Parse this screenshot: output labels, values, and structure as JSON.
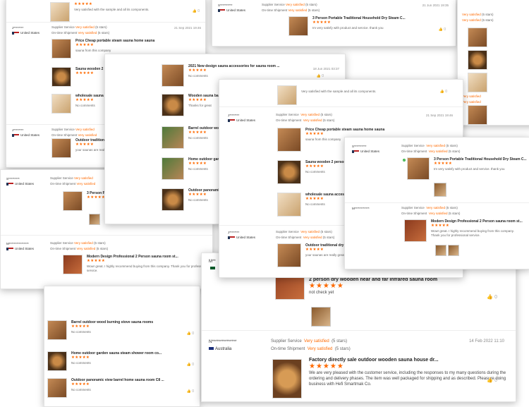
{
  "common": {
    "supplier_service": "Supplier Service",
    "ontime_shipment": "On-time Shipment",
    "very_satisfied": "Very satisfied",
    "five_stars": "(5 stars)",
    "stars": "★★★★★",
    "no_comments": "No comments",
    "country_us": "United States",
    "country_au": "Australia",
    "zero": "0"
  },
  "masks": {
    "s1": "S**********",
    "j1": "J********",
    "m1": "M****************",
    "s2": "S*********",
    "m2": "M************",
    "m3": "M**",
    "n1": "N***************"
  },
  "dates": {
    "d1": "21 Jun 2021 19:35",
    "d2": "21 Sep 2021 19:46",
    "d3": "18 Jun 2021 03:37",
    "d4": "14 Feb 2022 11:10"
  },
  "products": {
    "p_portable": "3 Person Portable Traditional Household Dry Steam C...",
    "p_price": "Price Cheap portable steam sauna home sauna",
    "p_wooden2": "Sauna wooden 2 person",
    "p_wholesale": "wholesale sauna accessories",
    "p_outdoor_dry": "Outdoor traditional dry steam",
    "p_modern": "Modern Design Professional 2 Person sauna room st...",
    "p_accessories": "2021 New design sauna accessories for sauna room ...",
    "p_wooden_sauna": "Wooden sauna barrel",
    "p_barrel_outdoor": "Barrel outdoor wood",
    "p_home_outdoor": "Home outdoor garden",
    "p_panoramic": "Outdoor panoramic",
    "p_barrel_stove": "Barrel outdoor wood burning stove sauna rooms",
    "p_home_shower": "Home outdoor garden sauna steam shower room co...",
    "p_panoramic_view": "Outdoor panoramic view barrel home sauna room C8 ...",
    "p_far_ir": "2 person dry wooden near and far infrared sauna room",
    "p_factory": "Factory directly sale outdoor wooden sauna house dr..."
  },
  "comments": {
    "c_sample": "Very satisfied with the sample and all its components.",
    "c_product": "Im very satisfy with product and service. thank you",
    "c_from": "sauna from this company",
    "c_thanks": "Thanks for great",
    "c_great": "your saunas are really great",
    "c_wow": "Wow! great. I highly recommend buying from this company. Thank you for professional service.",
    "c_notcheck": "not check yet",
    "c_long": "We are very pleased with the customer service, including the responses to my many questions during the ordering and delivery phases. The item was well packaged for shipping and as described. Pleasure doing business with Hefi Smartmak Co."
  }
}
